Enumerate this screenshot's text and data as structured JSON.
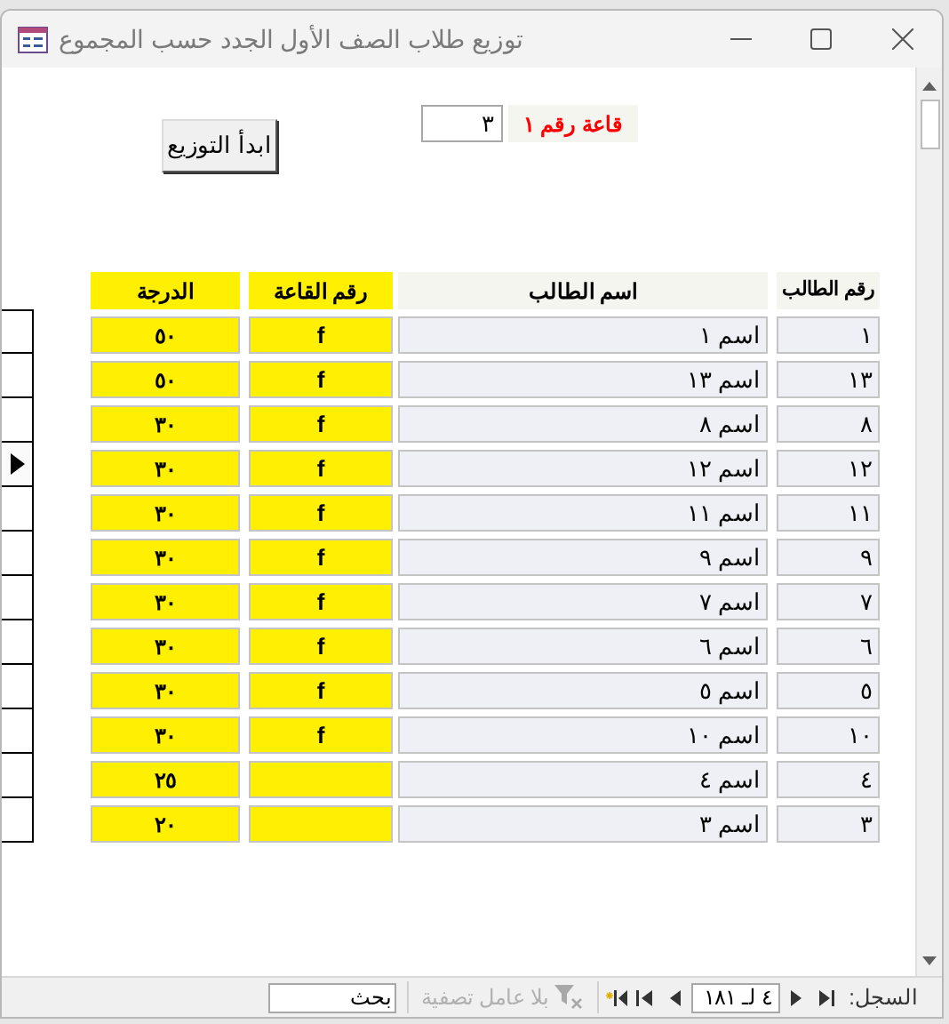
{
  "window": {
    "title": "توزيع طلاب الصف الأول الجدد حسب المجموع"
  },
  "hall": {
    "label": "قاعة رقم ١",
    "value": "٣"
  },
  "start_button": "ابدأ التوزيع",
  "table": {
    "columns": [
      "رقم الطالب",
      "اسم الطالب",
      "رقم القاعة",
      "الدرجة"
    ],
    "rows": [
      {
        "id": "١",
        "name": "اسم ١",
        "room": "f",
        "grade": "٥٠",
        "selected": false
      },
      {
        "id": "١٣",
        "name": "اسم ١٣",
        "room": "f",
        "grade": "٥٠",
        "selected": false
      },
      {
        "id": "٨",
        "name": "اسم ٨",
        "room": "f",
        "grade": "٣٠",
        "selected": false
      },
      {
        "id": "١٢",
        "name": "اسم ١٢",
        "room": "f",
        "grade": "٣٠",
        "selected": true
      },
      {
        "id": "١١",
        "name": "اسم ١١",
        "room": "f",
        "grade": "٣٠",
        "selected": false
      },
      {
        "id": "٩",
        "name": "اسم ٩",
        "room": "f",
        "grade": "٣٠",
        "selected": false
      },
      {
        "id": "٧",
        "name": "اسم ٧",
        "room": "f",
        "grade": "٣٠",
        "selected": false
      },
      {
        "id": "٦",
        "name": "اسم ٦",
        "room": "f",
        "grade": "٣٠",
        "selected": false
      },
      {
        "id": "٥",
        "name": "اسم ٥",
        "room": "f",
        "grade": "٣٠",
        "selected": false
      },
      {
        "id": "١٠",
        "name": "اسم ١٠",
        "room": "f",
        "grade": "٣٠",
        "selected": false
      },
      {
        "id": "٤",
        "name": "اسم ٤",
        "grade": "٢٥",
        "selected": false
      },
      {
        "id": "٣",
        "name": "اسم ٣",
        "grade": "٢٠",
        "selected": false
      }
    ]
  },
  "status_bar": {
    "record_label": "السجل:",
    "record_position": "٤ لـ ١٨١",
    "filter": {
      "label": "بلا عامل تصفية",
      "disabled": true
    },
    "search": {
      "placeholder": "بحث"
    }
  }
}
